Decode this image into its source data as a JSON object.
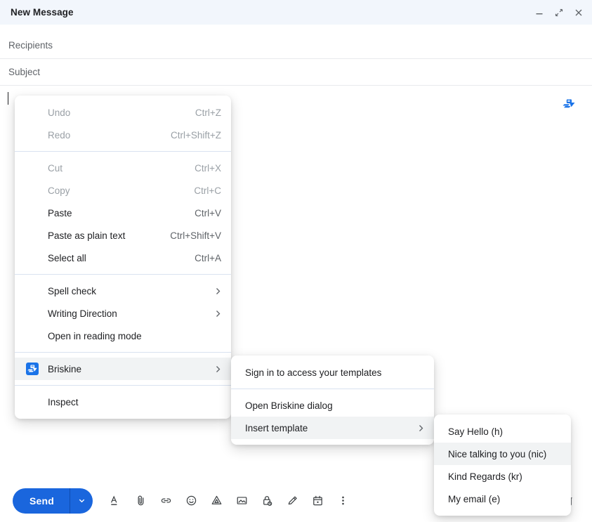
{
  "window": {
    "title": "New Message",
    "controls": [
      {
        "name": "minimize-button",
        "icon": "minimize-icon"
      },
      {
        "name": "popout-button",
        "icon": "popout-icon"
      },
      {
        "name": "close-button",
        "icon": "close-icon"
      }
    ]
  },
  "fields": {
    "recipients": {
      "label": "Recipients",
      "value": "",
      "placeholder": "Recipients"
    },
    "subject": {
      "label": "Subject",
      "value": "",
      "placeholder": "Subject"
    }
  },
  "body": {
    "value": "",
    "briskine_badge_icon": "briskine-logo-icon"
  },
  "toolbar": {
    "send_label": "Send",
    "send_dropdown_icon": "chevron-down-icon",
    "icons": [
      {
        "name": "formatting-options-icon",
        "glyph": "format-text"
      },
      {
        "name": "attach-file-icon",
        "glyph": "paperclip"
      },
      {
        "name": "insert-link-icon",
        "glyph": "link"
      },
      {
        "name": "insert-emoji-icon",
        "glyph": "emoji"
      },
      {
        "name": "insert-drive-file-icon",
        "glyph": "drive"
      },
      {
        "name": "insert-photo-icon",
        "glyph": "image"
      },
      {
        "name": "confidential-mode-icon",
        "glyph": "lock-clock"
      },
      {
        "name": "insert-signature-icon",
        "glyph": "pen"
      },
      {
        "name": "schedule-send-icon",
        "glyph": "calendar"
      },
      {
        "name": "more-options-icon",
        "glyph": "dots-vertical"
      }
    ],
    "discard_icon": "trash-icon"
  },
  "context_menu": {
    "groups": [
      {
        "items": [
          {
            "label": "Undo",
            "accel": "Ctrl+Z",
            "disabled": true,
            "submenu": false,
            "highlighted": false
          },
          {
            "label": "Redo",
            "accel": "Ctrl+Shift+Z",
            "disabled": true,
            "submenu": false,
            "highlighted": false
          }
        ]
      },
      {
        "items": [
          {
            "label": "Cut",
            "accel": "Ctrl+X",
            "disabled": true,
            "submenu": false,
            "highlighted": false
          },
          {
            "label": "Copy",
            "accel": "Ctrl+C",
            "disabled": true,
            "submenu": false,
            "highlighted": false
          },
          {
            "label": "Paste",
            "accel": "Ctrl+V",
            "disabled": false,
            "submenu": false,
            "highlighted": false
          },
          {
            "label": "Paste as plain text",
            "accel": "Ctrl+Shift+V",
            "disabled": false,
            "submenu": false,
            "highlighted": false
          },
          {
            "label": "Select all",
            "accel": "Ctrl+A",
            "disabled": false,
            "submenu": false,
            "highlighted": false
          }
        ]
      },
      {
        "items": [
          {
            "label": "Spell check",
            "accel": "",
            "disabled": false,
            "submenu": true,
            "highlighted": false
          },
          {
            "label": "Writing Direction",
            "accel": "",
            "disabled": false,
            "submenu": true,
            "highlighted": false
          },
          {
            "label": "Open in reading mode",
            "accel": "",
            "disabled": false,
            "submenu": false,
            "highlighted": false
          }
        ]
      },
      {
        "items": [
          {
            "label": "Briskine",
            "accel": "",
            "disabled": false,
            "submenu": true,
            "highlighted": true,
            "icon": "briskine-logo-icon"
          }
        ]
      },
      {
        "items": [
          {
            "label": "Inspect",
            "accel": "",
            "disabled": false,
            "submenu": false,
            "highlighted": false
          }
        ]
      }
    ]
  },
  "briskine_submenu": {
    "groups": [
      {
        "items": [
          {
            "label": "Sign in to access your templates",
            "submenu": false,
            "highlighted": false
          }
        ]
      },
      {
        "items": [
          {
            "label": "Open Briskine dialog",
            "submenu": false,
            "highlighted": false
          },
          {
            "label": "Insert template",
            "submenu": true,
            "highlighted": true
          }
        ]
      }
    ]
  },
  "templates_submenu": {
    "items": [
      {
        "label": "Say Hello (h)",
        "highlighted": false
      },
      {
        "label": "Nice talking to you (nic)",
        "highlighted": true
      },
      {
        "label": "Kind Regards (kr)",
        "highlighted": false
      },
      {
        "label": "My email (e)",
        "highlighted": false
      }
    ]
  },
  "colors": {
    "accent_blue": "#1a66dd",
    "header_bg": "#f2f6fc",
    "menu_highlight": "#f1f3f4",
    "separator": "#d9e2f0",
    "text_primary": "#202124",
    "text_secondary": "#5f6368",
    "text_disabled": "#9aa0a6"
  }
}
